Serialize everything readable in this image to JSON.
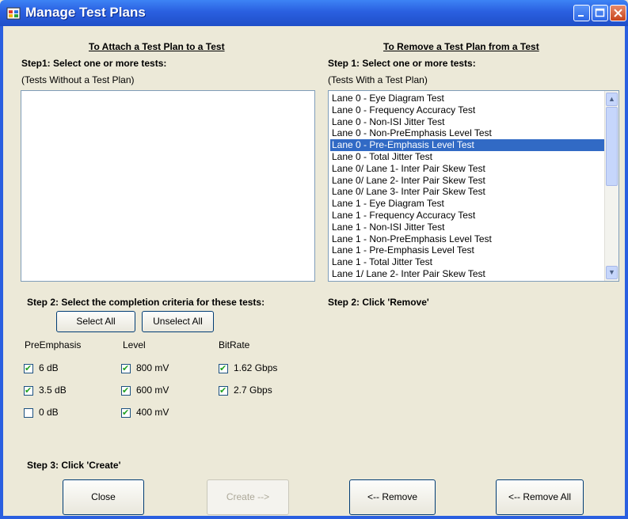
{
  "window": {
    "title": "Manage Test Plans"
  },
  "attach": {
    "heading": "To Attach a Test Plan to a Test",
    "step1": "Step1: Select one or more tests:",
    "list_caption": "(Tests Without a Test Plan)",
    "step2": "Step 2: Select the completion criteria for these tests:",
    "select_all": "Select All",
    "unselect_all": "Unselect All",
    "col_preemphasis": "PreEmphasis",
    "col_level": "Level",
    "col_bitrate": "BitRate",
    "preemphasis": [
      {
        "label": "6 dB",
        "checked": true
      },
      {
        "label": "3.5 dB",
        "checked": true
      },
      {
        "label": "0 dB",
        "checked": false
      }
    ],
    "level": [
      {
        "label": "800 mV",
        "checked": true
      },
      {
        "label": "600 mV",
        "checked": true
      },
      {
        "label": "400 mV",
        "checked": true
      }
    ],
    "bitrate": [
      {
        "label": "1.62 Gbps",
        "checked": true
      },
      {
        "label": "2.7 Gbps",
        "checked": true
      }
    ],
    "step3": "Step 3: Click 'Create'"
  },
  "remove": {
    "heading": "To Remove a Test Plan from a Test",
    "step1": "Step 1: Select one or more tests:",
    "list_caption": "(Tests With a Test Plan)",
    "tests": [
      "Lane 0 - Eye Diagram Test",
      "Lane 0 - Frequency Accuracy Test",
      "Lane 0 - Non-ISI Jitter Test",
      "Lane 0 - Non-PreEmphasis Level Test",
      "Lane 0 - Pre-Emphasis Level Test",
      "Lane 0 - Total Jitter Test",
      "Lane 0/ Lane 1- Inter Pair Skew Test",
      "Lane 0/ Lane 2- Inter Pair Skew Test",
      "Lane 0/ Lane 3- Inter Pair Skew Test",
      "Lane 1 - Eye Diagram Test",
      "Lane 1 - Frequency Accuracy Test",
      "Lane 1 - Non-ISI Jitter Test",
      "Lane 1 - Non-PreEmphasis Level Test",
      "Lane 1 - Pre-Emphasis Level Test",
      "Lane 1 - Total Jitter Test",
      "Lane 1/ Lane 2- Inter Pair Skew Test"
    ],
    "selected_index": 4,
    "step2": "Step 2: Click 'Remove'"
  },
  "buttons": {
    "close": "Close",
    "create": "Create -->",
    "remove": "<-- Remove",
    "remove_all": "<-- Remove All"
  },
  "colors": {
    "title_bar": "#2a5fe0",
    "selection": "#316ac5",
    "window_bg": "#ece9d8"
  }
}
